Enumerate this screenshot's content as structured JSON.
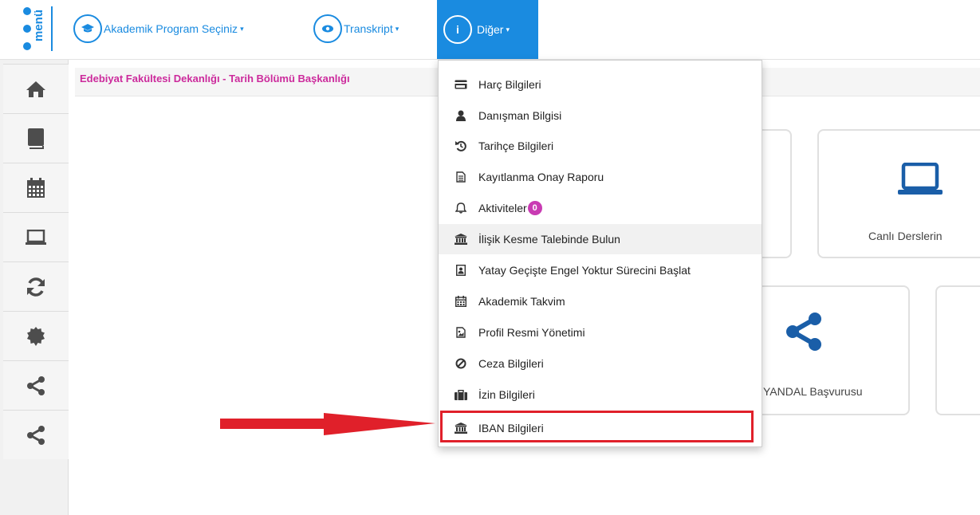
{
  "topbar": {
    "logo_text": "menü",
    "nav": [
      {
        "label": "Akademik Program Seçiniz",
        "icon": "graduation-cap-icon"
      },
      {
        "label": "Transkript",
        "icon": "eye-icon"
      },
      {
        "label": "Diğer",
        "icon": "info-icon"
      }
    ]
  },
  "sidebar": {
    "items": [
      "home-icon",
      "book-icon",
      "calendar-icon",
      "laptop-icon",
      "refresh-icon",
      "badge-icon",
      "share-icon",
      "share-icon"
    ]
  },
  "breadcrumb": "Edebiyat Fakültesi Dekanlığı - Tarih Bölümü Başkanlığı",
  "cards": {
    "live_lessons_label": "Canlı Derslerin",
    "yandal_label": "YANDAL Başvurusu"
  },
  "dropdown": {
    "items": [
      {
        "label": "Harç Bilgileri",
        "icon": "credit-card-icon"
      },
      {
        "label": "Danışman Bilgisi",
        "icon": "user-icon"
      },
      {
        "label": "Tarihçe Bilgileri",
        "icon": "history-icon"
      },
      {
        "label": "Kayıtlanma Onay Raporu",
        "icon": "document-icon"
      },
      {
        "label": "Aktiviteler",
        "icon": "bell-icon",
        "badge": "0"
      },
      {
        "label": "İlişik Kesme Talebinde Bulun",
        "icon": "bank-icon"
      },
      {
        "label": "Yatay Geçişte Engel Yoktur Sürecini Başlat",
        "icon": "portrait-icon"
      },
      {
        "label": "Akademik Takvim",
        "icon": "calendar-icon"
      },
      {
        "label": "Profil Resmi Yönetimi",
        "icon": "image-icon"
      },
      {
        "label": "Ceza Bilgileri",
        "icon": "ban-icon"
      },
      {
        "label": "İzin Bilgileri",
        "icon": "briefcase-icon"
      },
      {
        "label": "IBAN Bilgileri",
        "icon": "bank-icon"
      }
    ]
  },
  "colors": {
    "brand": "#1a8be0",
    "breadcrumb": "#cc2a9c",
    "badge": "#c93bb3",
    "highlight": "#e0202a"
  }
}
